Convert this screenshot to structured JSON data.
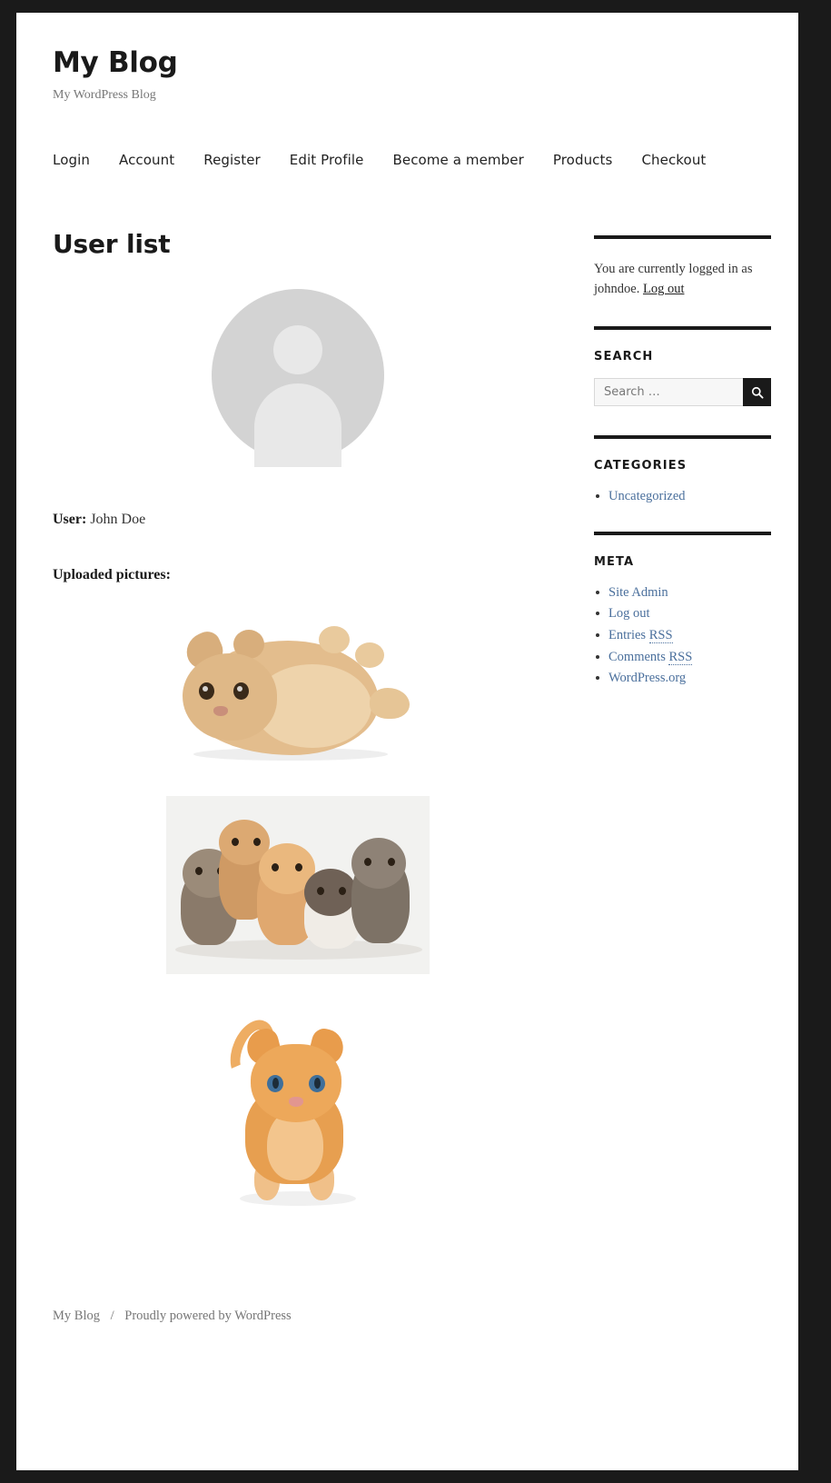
{
  "site": {
    "title": "My Blog",
    "description": "My WordPress Blog"
  },
  "nav": {
    "items": [
      {
        "label": "Login"
      },
      {
        "label": "Account"
      },
      {
        "label": "Register"
      },
      {
        "label": "Edit Profile"
      },
      {
        "label": "Become a member"
      },
      {
        "label": "Products"
      },
      {
        "label": "Checkout"
      }
    ]
  },
  "main": {
    "page_title": "User list",
    "avatar_alt": "default-avatar",
    "user_label": "User:",
    "user_name": "John Doe",
    "uploaded_label": "Uploaded pictures:",
    "pictures": [
      {
        "alt": "kitten-lying-on-back"
      },
      {
        "alt": "group-of-five-kittens"
      },
      {
        "alt": "orange-kitten-standing"
      }
    ]
  },
  "sidebar": {
    "login_status": {
      "text_prefix": "You are currently logged in as johndoe.",
      "logout_label": "Log out"
    },
    "search": {
      "title": "Search",
      "placeholder": "Search …",
      "submit_icon": "search-icon"
    },
    "categories": {
      "title": "Categories",
      "items": [
        {
          "label": "Uncategorized"
        }
      ]
    },
    "meta": {
      "title": "Meta",
      "items": [
        {
          "label": "Site Admin",
          "abbr": ""
        },
        {
          "label": "Log out",
          "abbr": ""
        },
        {
          "label": "Entries ",
          "abbr": "RSS"
        },
        {
          "label": "Comments ",
          "abbr": "RSS"
        },
        {
          "label": "WordPress.org",
          "abbr": ""
        }
      ]
    }
  },
  "footer": {
    "site_link": "My Blog",
    "separator": "/",
    "credit": "Proudly powered by WordPress"
  },
  "colors": {
    "accent_link": "#4a6f9c",
    "text": "#333333",
    "heading": "#1a1a1a",
    "muted": "#767676",
    "page_background": "#1a1a1a"
  }
}
